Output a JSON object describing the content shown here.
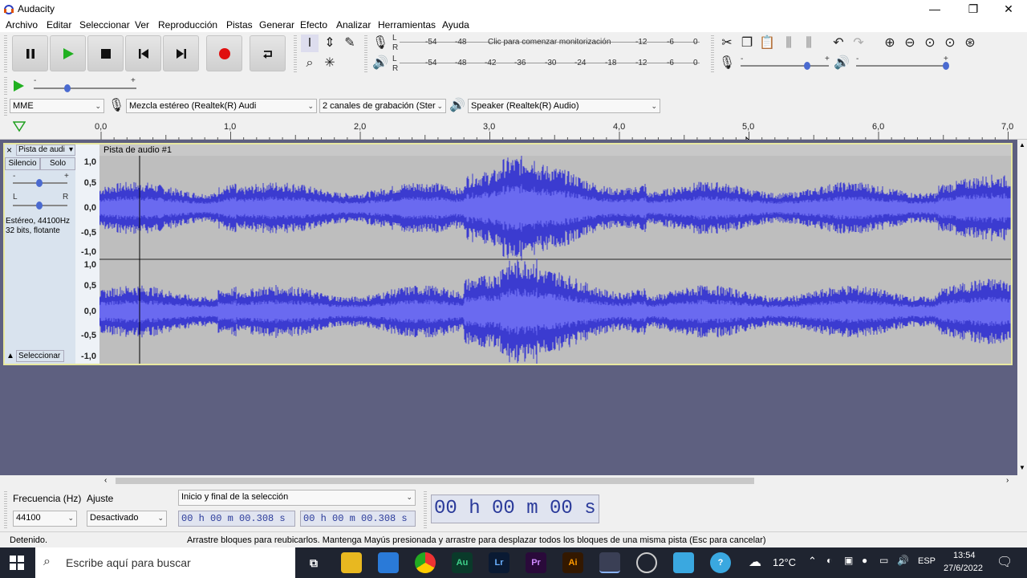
{
  "window": {
    "title": "Audacity",
    "minimize": "—",
    "restore": "❐",
    "close": "✕"
  },
  "menu": [
    "Archivo",
    "Editar",
    "Seleccionar",
    "Ver",
    "Reproducción",
    "Pistas",
    "Generar",
    "Efecto",
    "Analizar",
    "Herramientas",
    "Ayuda"
  ],
  "meters": {
    "record_scale": [
      "-54",
      "-48",
      "-12",
      "-6",
      "0"
    ],
    "record_prompt": "Clic para comenzar monitorización",
    "play_scale": [
      "-54",
      "-48",
      "-42",
      "-36",
      "-30",
      "-24",
      "-18",
      "-12",
      "-6",
      "0"
    ],
    "channel_l": "L",
    "channel_r": "R"
  },
  "sliders": {
    "minus": "-",
    "plus": "+"
  },
  "device": {
    "host": "MME",
    "recording_device": "Mezcla estéreo (Realtek(R) Audi",
    "channels": "2 canales de grabación (Ster",
    "playback_device": "Speaker (Realtek(R) Audio)"
  },
  "ruler": {
    "ticks": [
      "0,0",
      "1,0",
      "2,0",
      "3,0",
      "4,0",
      "5,0",
      "6,0",
      "7,0"
    ]
  },
  "track": {
    "name": "Pista de audi",
    "clip_name": "Pista de audio #1",
    "mute": "Silencio",
    "solo": "Solo",
    "gain_minus": "-",
    "gain_plus": "+",
    "pan_l": "L",
    "pan_r": "R",
    "info_line1": "Estéreo, 44100Hz",
    "info_line2": "32 bits, flotante",
    "select_button": "Seleccionar",
    "close": "×",
    "vruler": [
      "1,0",
      "0,5",
      "0,0",
      "-0,5",
      "-1,0"
    ]
  },
  "selection_bar": {
    "rate_label": "Frecuencia (Hz)",
    "rate_value": "44100",
    "snap_label": "Ajuste",
    "snap_value": "Desactivado",
    "mode": "Inicio y final de la selección",
    "start_time": "00 h 00 m 00.308 s",
    "end_time": "00 h 00 m 00.308 s",
    "big_time": "00 h 00 m 00 s"
  },
  "status": {
    "state": "Detenido.",
    "hint": "Arrastre bloques para reubicarlos. Mantenga Mayús presionada y arrastre para desplazar todos los bloques de una misma pista (Esc para cancelar)"
  },
  "taskbar": {
    "search_placeholder": "Escribe aquí para buscar",
    "temperature": "12°C",
    "language": "ESP",
    "time": "13:54",
    "date": "27/6/2022",
    "apps": [
      "Au",
      "Lr",
      "Pr",
      "Ai"
    ]
  },
  "colors": {
    "wave": "#3b3bd0",
    "wave_rms": "#6a6af0",
    "track_bg": "#bebebe",
    "panel_bg": "#5e6080",
    "big_time": "#2a3a9a"
  },
  "icons": [
    "pause-icon",
    "play-icon",
    "stop-icon",
    "skip-start-icon",
    "skip-end-icon",
    "record-icon",
    "loop-icon"
  ]
}
